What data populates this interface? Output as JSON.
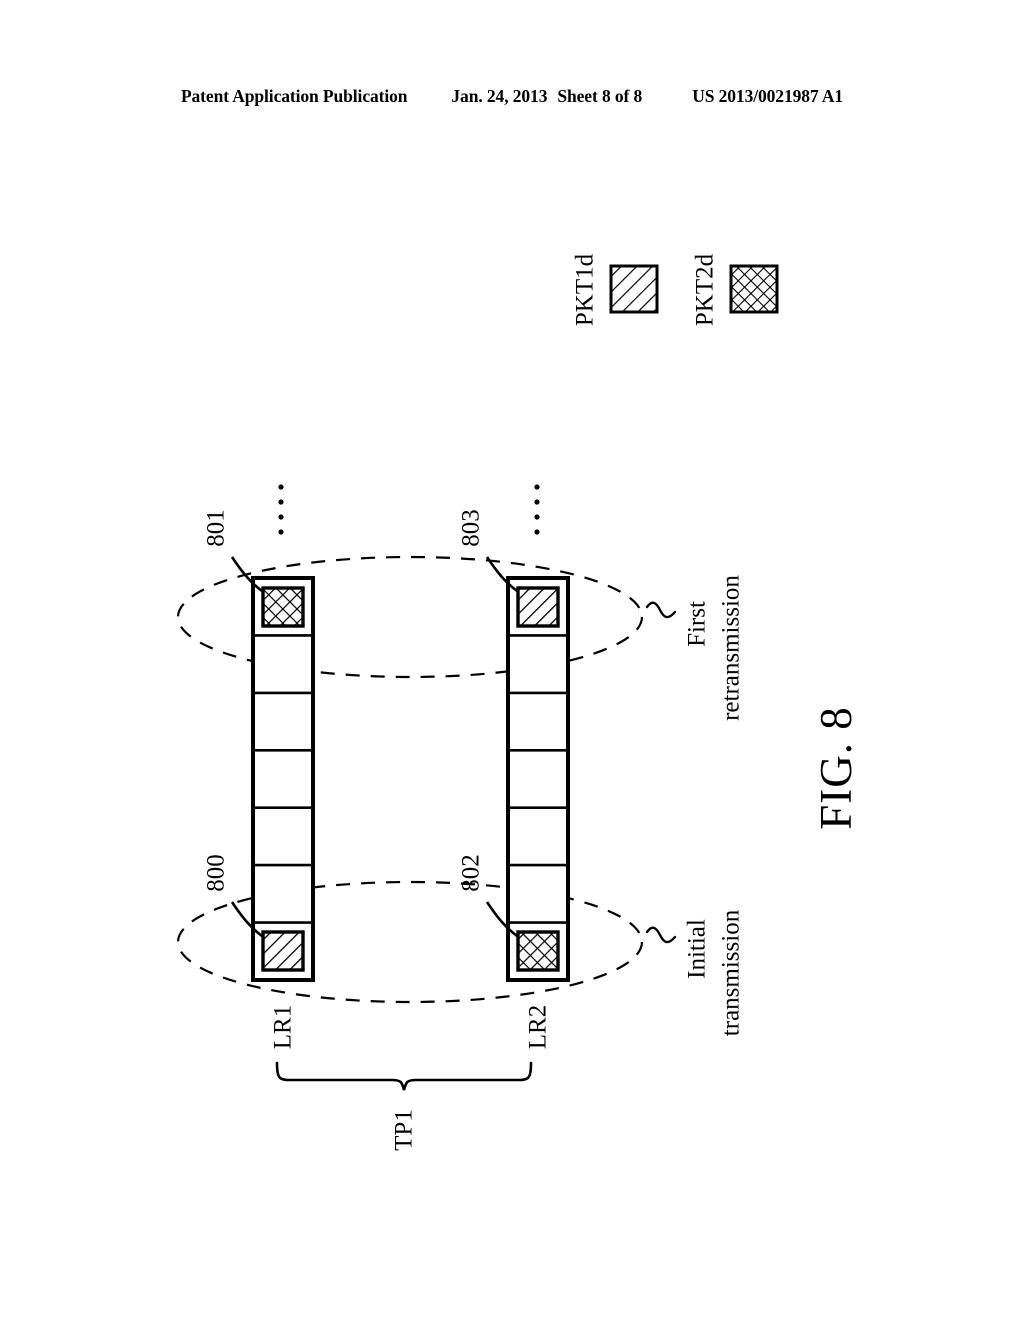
{
  "header": {
    "publication": "Patent Application Publication",
    "date": "Jan. 24, 2013",
    "sheet": "Sheet 8 of 8",
    "patent_number": "US 2013/0021987 A1"
  },
  "figure": {
    "title": "FIG. 8",
    "rows": [
      {
        "id": "LR1",
        "label": "LR1",
        "cells": [
          {
            "index": 0,
            "fill": "crosshatch",
            "ref": "801"
          },
          {
            "index": 1,
            "fill": "none",
            "ref": ""
          },
          {
            "index": 2,
            "fill": "none",
            "ref": ""
          },
          {
            "index": 3,
            "fill": "none",
            "ref": ""
          },
          {
            "index": 4,
            "fill": "none",
            "ref": ""
          },
          {
            "index": 5,
            "fill": "none",
            "ref": ""
          },
          {
            "index": 6,
            "fill": "diagonal",
            "ref": "800"
          }
        ]
      },
      {
        "id": "LR2",
        "label": "LR2",
        "cells": [
          {
            "index": 0,
            "fill": "diagonal",
            "ref": "803"
          },
          {
            "index": 1,
            "fill": "none",
            "ref": ""
          },
          {
            "index": 2,
            "fill": "none",
            "ref": ""
          },
          {
            "index": 3,
            "fill": "none",
            "ref": ""
          },
          {
            "index": 4,
            "fill": "none",
            "ref": ""
          },
          {
            "index": 5,
            "fill": "none",
            "ref": ""
          },
          {
            "index": 6,
            "fill": "crosshatch",
            "ref": "802"
          }
        ]
      }
    ],
    "reference_numerals": {
      "r800": "800",
      "r801": "801",
      "r802": "802",
      "r803": "803"
    },
    "group_brace": {
      "label": "TP1"
    },
    "phases": [
      {
        "id": "first-retransmission",
        "line1": "First",
        "line2": "retransmission"
      },
      {
        "id": "initial-transmission",
        "line1": "Initial",
        "line2": "transmission"
      }
    ],
    "legend": [
      {
        "label": "PKT1d",
        "pattern": "diagonal"
      },
      {
        "label": "PKT2d",
        "pattern": "crosshatch"
      }
    ]
  }
}
